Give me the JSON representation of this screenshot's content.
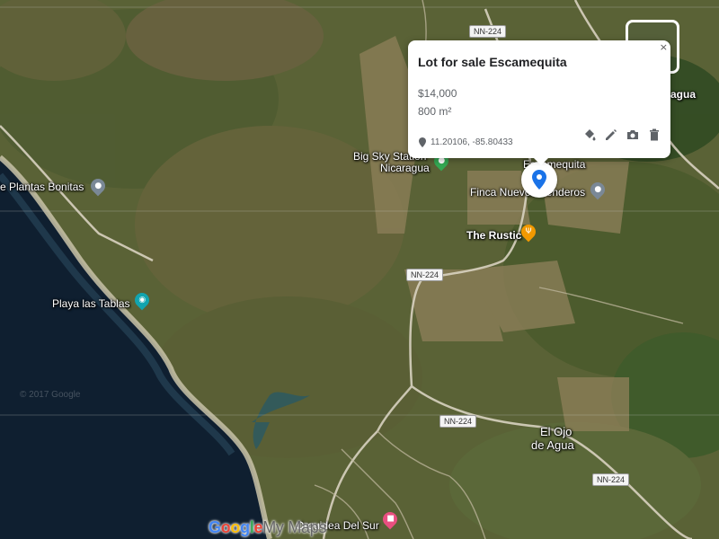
{
  "map": {
    "roads": [
      "NN-224",
      "NN-224",
      "NN-224",
      "NN-224"
    ],
    "places": {
      "plantas": "e Plantas Bonitas",
      "playa": "Playa las Tablas",
      "bigsky": "Big Sky Station",
      "nicaragua": "Nicaragua",
      "escamequita": "Escamequita",
      "finca": "Finca Nuevos Senderos",
      "rustic": "The Rustic",
      "ojo1": "El Ojo",
      "ojo2": "de Agua",
      "orquidea": "Orquidea Del Sur",
      "agua_corner": "agua"
    },
    "watermark": "© 2017 Google"
  },
  "popup": {
    "title": "Lot for sale Escamequita",
    "price": "$14,000",
    "area": "800 m²",
    "coords": "11.20106, -85.80433",
    "close_label": "×"
  },
  "footer": {
    "google": [
      "G",
      "o",
      "o",
      "g",
      "l",
      "e"
    ],
    "mymaps": "My Maps"
  },
  "icons": [
    "pin-icon",
    "fill-bucket-icon",
    "pencil-icon",
    "camera-icon",
    "trash-icon",
    "close-icon",
    "place-marker-icon",
    "restaurant-icon",
    "hotel-icon",
    "camera-poi-icon"
  ],
  "colors": {
    "marker": "#1a73e8",
    "poi_gray": "#7a8896",
    "poi_orange": "#f29900",
    "poi_green": "#34a853",
    "poi_teal": "#12a4af",
    "poi_pink": "#e94f80"
  }
}
